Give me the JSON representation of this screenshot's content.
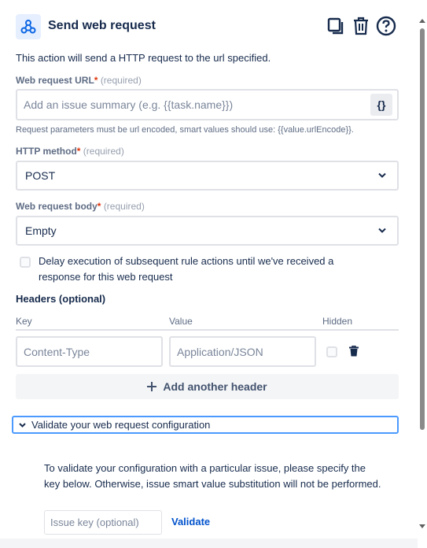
{
  "header": {
    "title": "Send web request"
  },
  "description": "This action will send a HTTP request to the url specified.",
  "url_field": {
    "label": "Web request URL",
    "required_mark": "*",
    "required_text": "(required)",
    "placeholder": "Add an issue summary (e.g. {{task.name}})",
    "smart_value_button": "{}",
    "hint": "Request parameters must be url encoded, smart values should use: {{value.urlEncode}}."
  },
  "method_field": {
    "label": "HTTP method",
    "required_mark": "*",
    "required_text": "(required)",
    "value": "POST"
  },
  "body_field": {
    "label": "Web request body",
    "required_mark": "*",
    "required_text": "(required)",
    "value": "Empty"
  },
  "delay_checkbox": {
    "label": "Delay execution of subsequent rule actions until we've received a response for this web request",
    "checked": false
  },
  "headers": {
    "title": "Headers (optional)",
    "columns": [
      "Key",
      "Value",
      "Hidden"
    ],
    "rows": [
      {
        "key_placeholder": "Content-Type",
        "value_placeholder": "Application/JSON",
        "hidden": false
      }
    ],
    "add_label": "Add another header"
  },
  "validate": {
    "toggle_label": "Validate your web request configuration",
    "expanded": true,
    "description": "To validate your configuration with a particular issue, please specify the key below. Otherwise, issue smart value substitution will not be performed.",
    "issue_key_placeholder": "Issue key (optional)",
    "button_label": "Validate"
  },
  "colors": {
    "accent": "#0052cc",
    "focus_border": "#4c9aff",
    "highlight": "#fbff3a"
  }
}
